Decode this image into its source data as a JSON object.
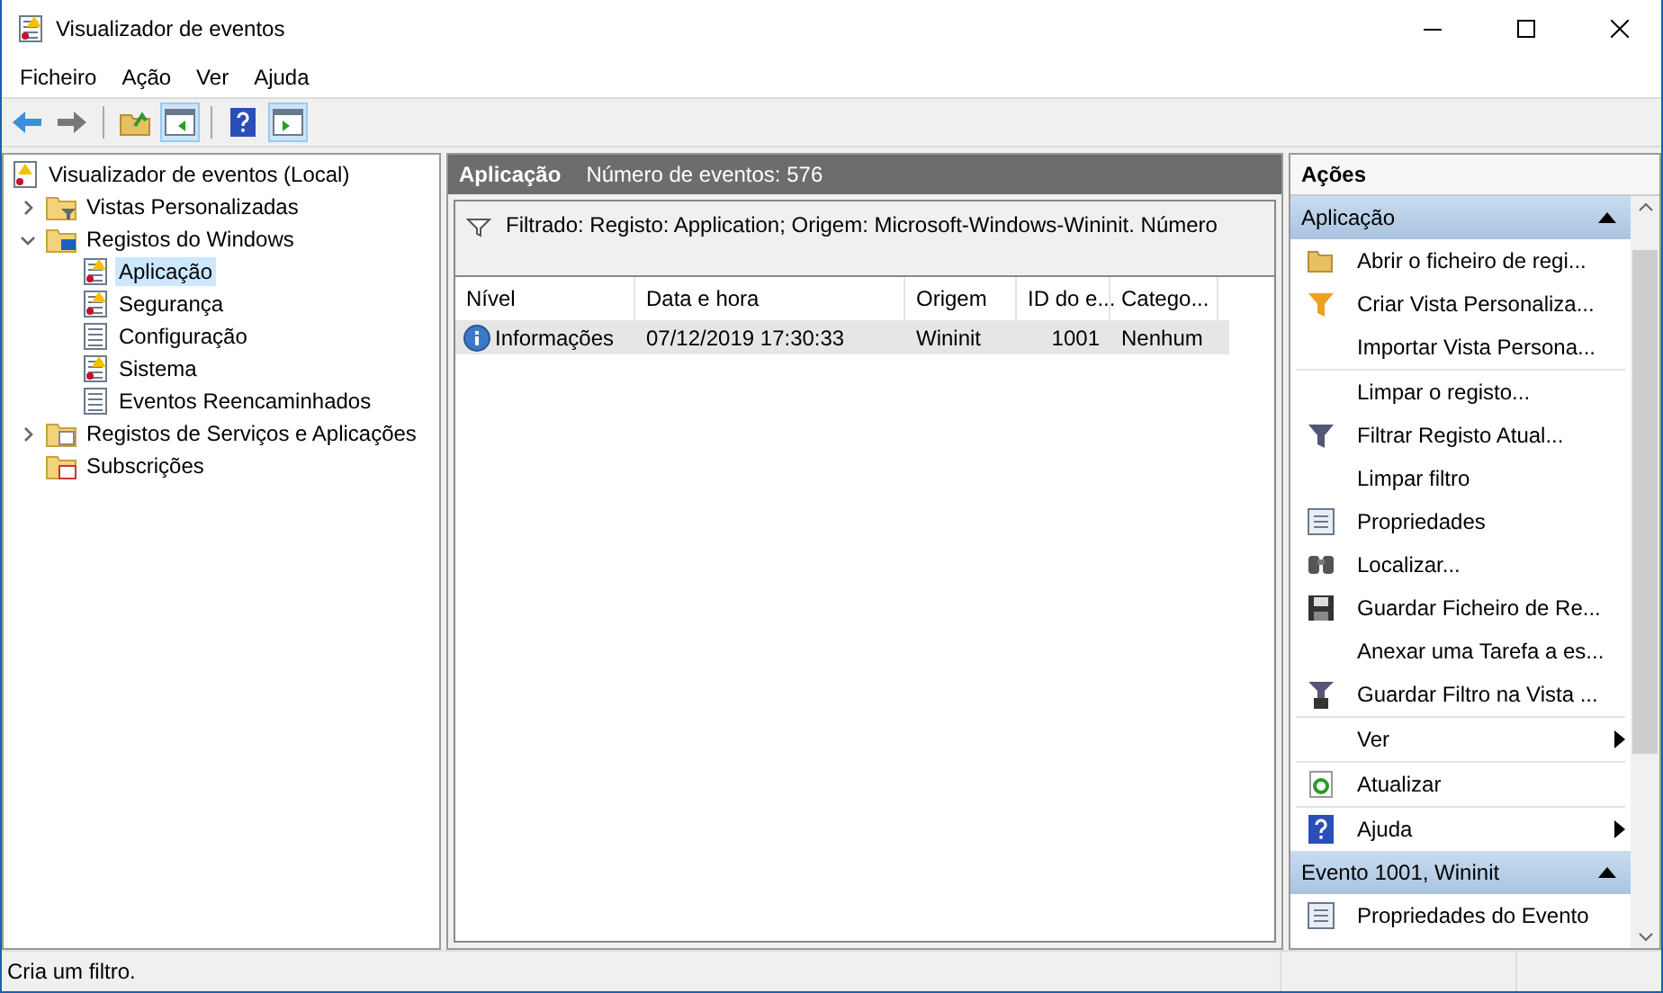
{
  "window": {
    "title": "Visualizador de eventos"
  },
  "menu": [
    "Ficheiro",
    "Ação",
    "Ver",
    "Ajuda"
  ],
  "toolbar": [
    {
      "kind": "back",
      "pressed": false
    },
    {
      "kind": "forward",
      "pressed": false
    },
    {
      "kind": "sep"
    },
    {
      "kind": "up",
      "pressed": false
    },
    {
      "kind": "tree",
      "pressed": true
    },
    {
      "kind": "sep"
    },
    {
      "kind": "help",
      "pressed": false
    },
    {
      "kind": "pane",
      "pressed": true
    }
  ],
  "tree": [
    {
      "label": "Visualizador de eventos (Local)",
      "kind": "root",
      "selected": false,
      "children": [
        {
          "label": "Vistas Personalizadas",
          "kind": "views",
          "expanded": false,
          "selected": false
        },
        {
          "label": "Registos do Windows",
          "kind": "windows",
          "expanded": true,
          "selected": false,
          "children": [
            {
              "label": "Aplicação",
              "kind": "log-warn",
              "selected": true
            },
            {
              "label": "Segurança",
              "kind": "log-warn",
              "selected": false
            },
            {
              "label": "Configuração",
              "kind": "log",
              "selected": false
            },
            {
              "label": "Sistema",
              "kind": "log-warn",
              "selected": false
            },
            {
              "label": "Eventos Reencaminhados",
              "kind": "log",
              "selected": false
            }
          ]
        },
        {
          "label": "Registos de Serviços e Aplicações",
          "kind": "folder",
          "expanded": false,
          "selected": false
        },
        {
          "label": "Subscrições",
          "kind": "subs",
          "selected": false
        }
      ]
    }
  ],
  "center": {
    "title": "Aplicação",
    "count": "Número de eventos: 576",
    "filter": "Filtrado: Registo: Application; Origem: Microsoft-Windows-Wininit. Número",
    "columns": [
      "Nível",
      "Data e hora",
      "Origem",
      "ID do e...",
      "Catego..."
    ],
    "rows": [
      {
        "selected": true,
        "cells": [
          "Informações",
          "07/12/2019 17:30:33",
          "Wininit",
          "1001",
          "Nenhum"
        ]
      }
    ]
  },
  "actions": {
    "title": "Ações",
    "sections": [
      {
        "title": "Aplicação",
        "expanded": true,
        "items": [
          {
            "label": "Abrir o ficheiro de regi...",
            "kind": "open"
          },
          {
            "label": "Criar Vista Personaliza...",
            "kind": "create-view"
          },
          {
            "label": "Importar Vista Persona...",
            "kind": "plain"
          },
          {
            "label": "Limpar o registo...",
            "kind": "plain",
            "separator": true
          },
          {
            "label": "Filtrar Registo Atual...",
            "kind": "filter"
          },
          {
            "label": "Limpar filtro",
            "kind": "plain"
          },
          {
            "label": "Propriedades",
            "kind": "properties"
          },
          {
            "label": "Localizar...",
            "kind": "find"
          },
          {
            "label": "Guardar Ficheiro de Re...",
            "kind": "save"
          },
          {
            "label": "Anexar uma Tarefa a es...",
            "kind": "plain"
          },
          {
            "label": "Guardar Filtro na Vista ...",
            "kind": "save-filter"
          },
          {
            "label": "Ver",
            "kind": "submenu",
            "separator": true
          },
          {
            "label": "Atualizar",
            "kind": "refresh",
            "separator": true
          },
          {
            "label": "Ajuda",
            "kind": "help-submenu",
            "separator": true
          }
        ]
      },
      {
        "title": "Evento 1001, Wininit",
        "expanded": true,
        "items": [
          {
            "label": "Propriedades do Evento",
            "kind": "properties"
          }
        ]
      }
    ]
  },
  "status": "Cria um filtro."
}
